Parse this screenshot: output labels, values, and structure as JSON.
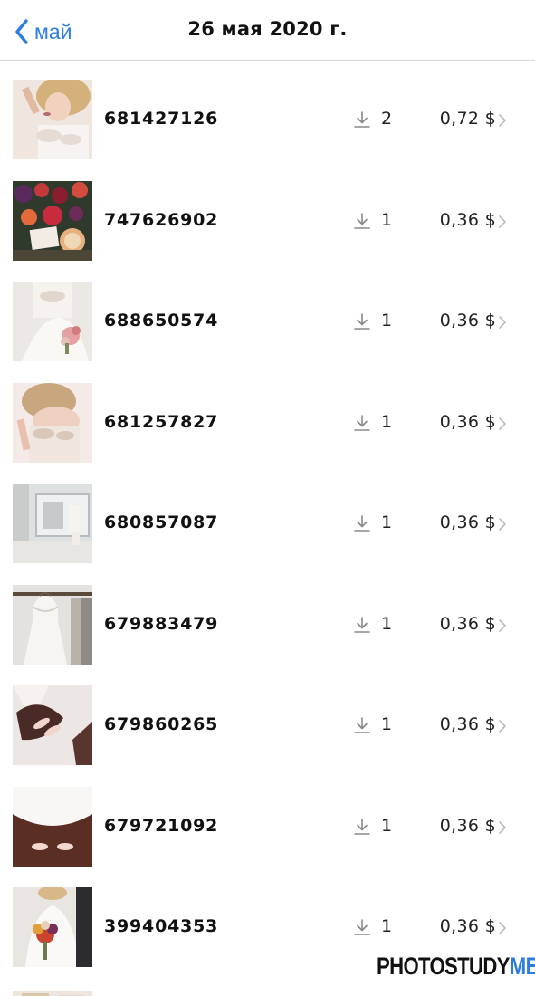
{
  "navbar": {
    "back_label": "май",
    "title": "26 мая 2020 г.",
    "accent_color": "#2b7de1"
  },
  "items": [
    {
      "id": "681427126",
      "downloads": "2",
      "price": "0,72 $"
    },
    {
      "id": "747626902",
      "downloads": "1",
      "price": "0,36 $"
    },
    {
      "id": "688650574",
      "downloads": "1",
      "price": "0,36 $"
    },
    {
      "id": "681257827",
      "downloads": "1",
      "price": "0,36 $"
    },
    {
      "id": "680857087",
      "downloads": "1",
      "price": "0,36 $"
    },
    {
      "id": "679883479",
      "downloads": "1",
      "price": "0,36 $"
    },
    {
      "id": "679860265",
      "downloads": "1",
      "price": "0,36 $"
    },
    {
      "id": "679721092",
      "downloads": "1",
      "price": "0,36 $"
    },
    {
      "id": "399404353",
      "downloads": "1",
      "price": "0,36 $"
    }
  ],
  "icons": {
    "back": "chevron-left-icon",
    "download": "download-icon",
    "disclosure": "chevron-right-icon"
  },
  "watermark": {
    "part1": "PHOTOSTUDY",
    "part2": "ME"
  }
}
